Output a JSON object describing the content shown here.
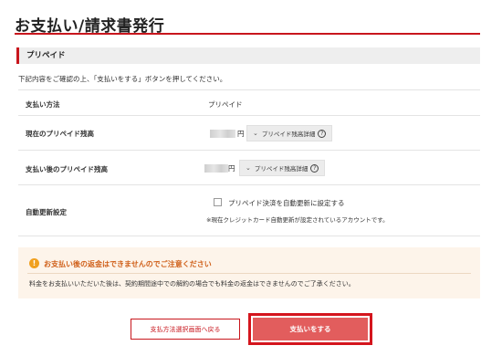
{
  "page": {
    "title": "お支払い/請求書発行"
  },
  "section": {
    "title": "プリペイド"
  },
  "instruction": "下記内容をご確認の上、「支払いをする」ボタンを押してください。",
  "rows": {
    "payment_method": {
      "label": "支払い方法",
      "value": "プリペイド"
    },
    "current_balance": {
      "label": "現在のプリペイド残高",
      "currency": "円",
      "detail_button": "プリペイド残高詳細"
    },
    "balance_after": {
      "label": "支払い後のプリペイド残高",
      "currency": "円",
      "detail_button": "プリペイド残高詳細"
    },
    "auto_renew": {
      "label": "自動更新設定",
      "checkbox_label": "プリペイド決済を自動更新に設定する",
      "checked": false,
      "note": "※現在クレジットカード自動更新が設定されているアカウントです。"
    }
  },
  "notice": {
    "icon": "exclamation-icon",
    "title": "お支払い後の返金はできませんのでご注意ください",
    "body": "料金をお支払いいただいた後は、契約期間途中での解約の場合でも料金の返金はできませんのでご了承ください。"
  },
  "buttons": {
    "back": "支払方法選択画面へ戻る",
    "pay": "支払いをする"
  },
  "colors": {
    "accent": "#c8161d",
    "pay_button": "#e25d5d",
    "notice_bg": "#fdf4ea",
    "notice_title": "#d0601a"
  }
}
